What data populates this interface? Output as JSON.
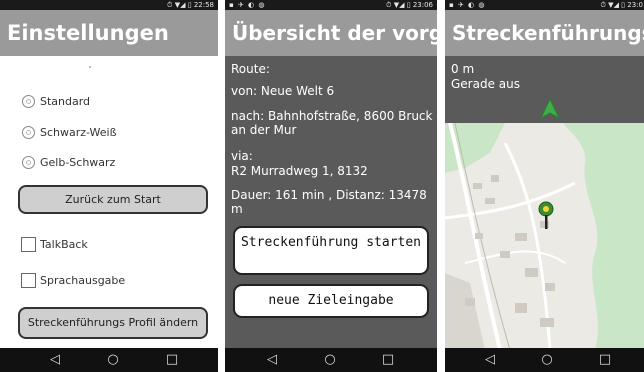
{
  "screens": {
    "settings": {
      "status": {
        "icons_left": "",
        "time": "22:58"
      },
      "title": "Einstellungen",
      "radio_options": [
        {
          "label": "Standard"
        },
        {
          "label": "Schwarz-Weiß"
        },
        {
          "label": "Gelb-Schwarz"
        }
      ],
      "back_button_label": "Zurück zum Start",
      "checkboxes": [
        {
          "label": "TalkBack",
          "checked": false
        },
        {
          "label": "Sprachausgabe",
          "checked": false
        }
      ],
      "profile_button_label": "Streckenführungs Profil ändern"
    },
    "overview": {
      "status": {
        "icons_left": "▪ ✈ ◐ ◍",
        "time": "23:06"
      },
      "title": "Übersicht der vorg...",
      "route_label": "Route:",
      "from": "von: Neue Welt 6",
      "to": "nach: Bahnhofstraße, 8600 Bruck an der Mur",
      "via_label": "via:",
      "via": "R2 Murradweg 1, 8132",
      "duration_distance": "Dauer: 161 min , Distanz: 13478 m",
      "start_button_label": "Streckenführung starten",
      "new_destination_button_label": "neue Zieleingabe"
    },
    "navigation": {
      "status": {
        "icons_left": "▪ ✈ ◐ ◍",
        "time": "23:0"
      },
      "title": "Streckenführungs...",
      "distance": "0 m",
      "instruction": "Gerade aus",
      "colors": {
        "arrow": "#3fae49",
        "map_green": "#c9e6c7",
        "pin": "#3b8c2f"
      }
    }
  },
  "navbar": {
    "back_icon": "◁",
    "home_icon": "○",
    "recents_icon": "□"
  },
  "icons": {
    "time_icons": "⏱ ▼◢ ▯"
  }
}
